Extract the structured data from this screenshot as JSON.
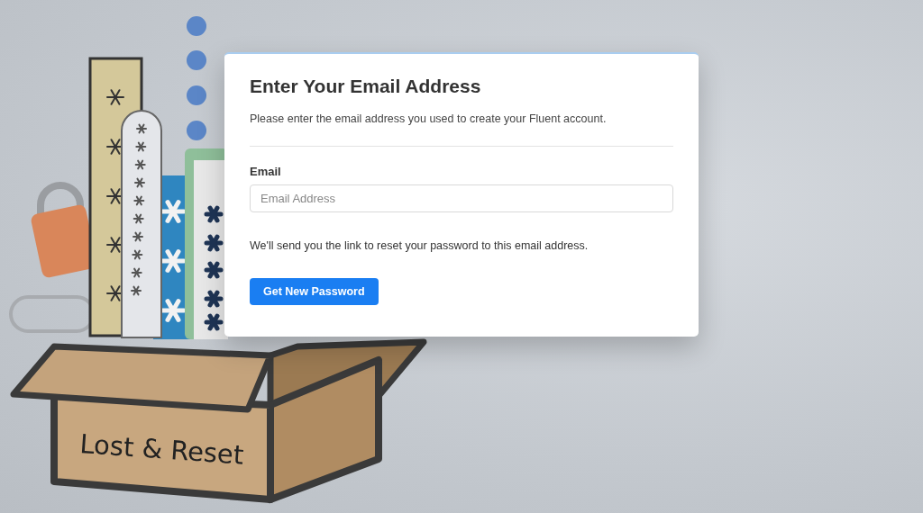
{
  "illustration": {
    "box_label": "Lost & Reset"
  },
  "card": {
    "title": "Enter Your Email Address",
    "intro": "Please enter the email address you used to create your Fluent account.",
    "field": {
      "label": "Email",
      "placeholder": "Email Address"
    },
    "note": "We'll send you the link to reset your password to this email address.",
    "button": "Get New Password"
  }
}
